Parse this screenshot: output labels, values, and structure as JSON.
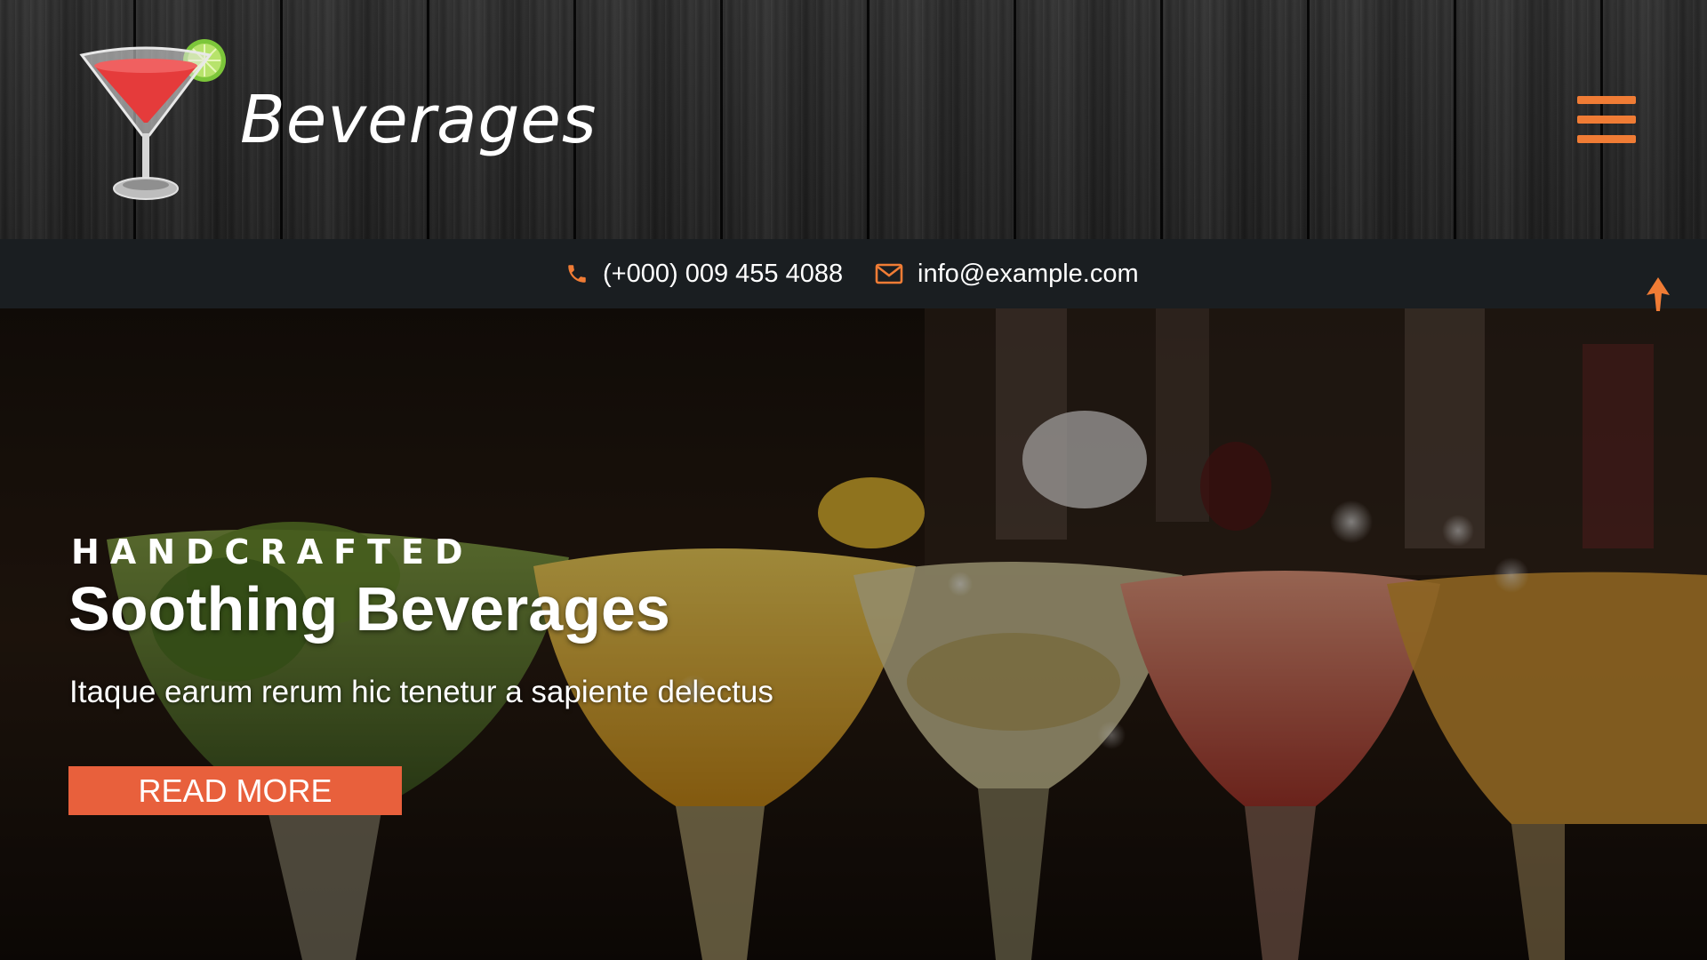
{
  "colors": {
    "accent": "#f07c35",
    "button": "#e8603c",
    "contact_bar": "#1a1e21"
  },
  "brand": {
    "name": "Beverages",
    "logo_icon": "cocktail-glass-icon"
  },
  "header": {
    "menu_icon": "hamburger-menu-icon"
  },
  "contact": {
    "phone_icon": "phone-icon",
    "phone": "(+000) 009 455 4088",
    "email_icon": "envelope-icon",
    "email": "info@example.com"
  },
  "scroll_top": {
    "icon": "arrow-up-icon"
  },
  "hero": {
    "kicker": "HANDCRAFTED",
    "title": "Soothing Beverages",
    "subtitle": "Itaque earum rerum hic tenetur a sapiente delectus",
    "button_label": "READ MORE"
  }
}
